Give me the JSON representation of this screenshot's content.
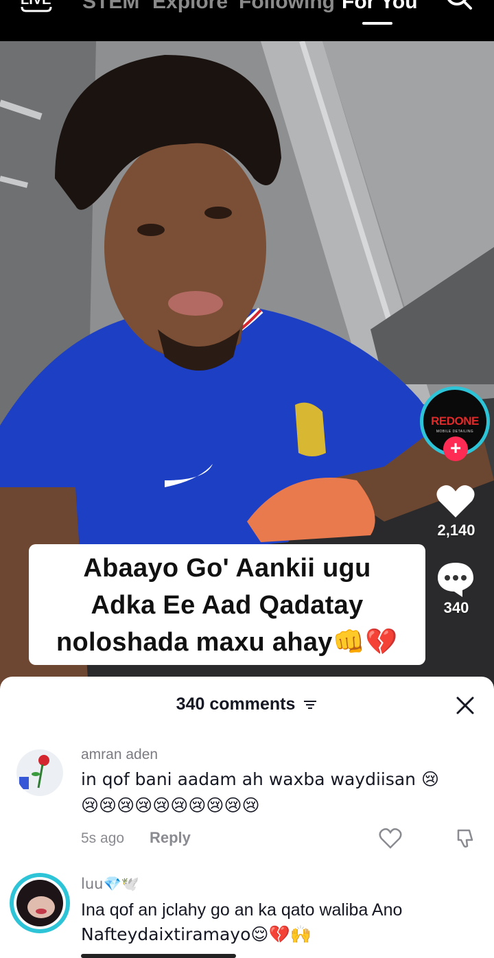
{
  "topnav": {
    "live_label": "LIVE",
    "tabs": [
      "STEM",
      "Explore",
      "Following",
      "For You"
    ],
    "active_tab": "For You"
  },
  "video": {
    "caption_lines": [
      "Abaayo Go' Aankii ugu",
      "Adka Ee Aad Qadatay",
      "noloshada maxu ahay👊💔"
    ]
  },
  "creator": {
    "avatar_text": "REDONE",
    "avatar_subtext": "MOBILE DETAILING",
    "follow_symbol": "+"
  },
  "actions": {
    "like_count": "2,140",
    "comment_count": "340"
  },
  "comments_sheet": {
    "title": "340 comments",
    "comments": [
      {
        "username": "amran aden",
        "text_line1": "in qof bani aadam ah waxba waydiisan 😢",
        "text_line2": "😢😢😢😢😢😢😢😢😢😢",
        "time": "5s ago",
        "reply_label": "Reply"
      },
      {
        "username": "luu💎🕊️",
        "text_line1": "Ina qof an jclahy go an ka qato waliba Ano",
        "text_line2": "Nafteydaixtiramayo😌💔🙌"
      }
    ]
  },
  "colors": {
    "accent": "#fe2c55",
    "ring": "#2ec4d8",
    "jersey": "#1d3fc4"
  }
}
